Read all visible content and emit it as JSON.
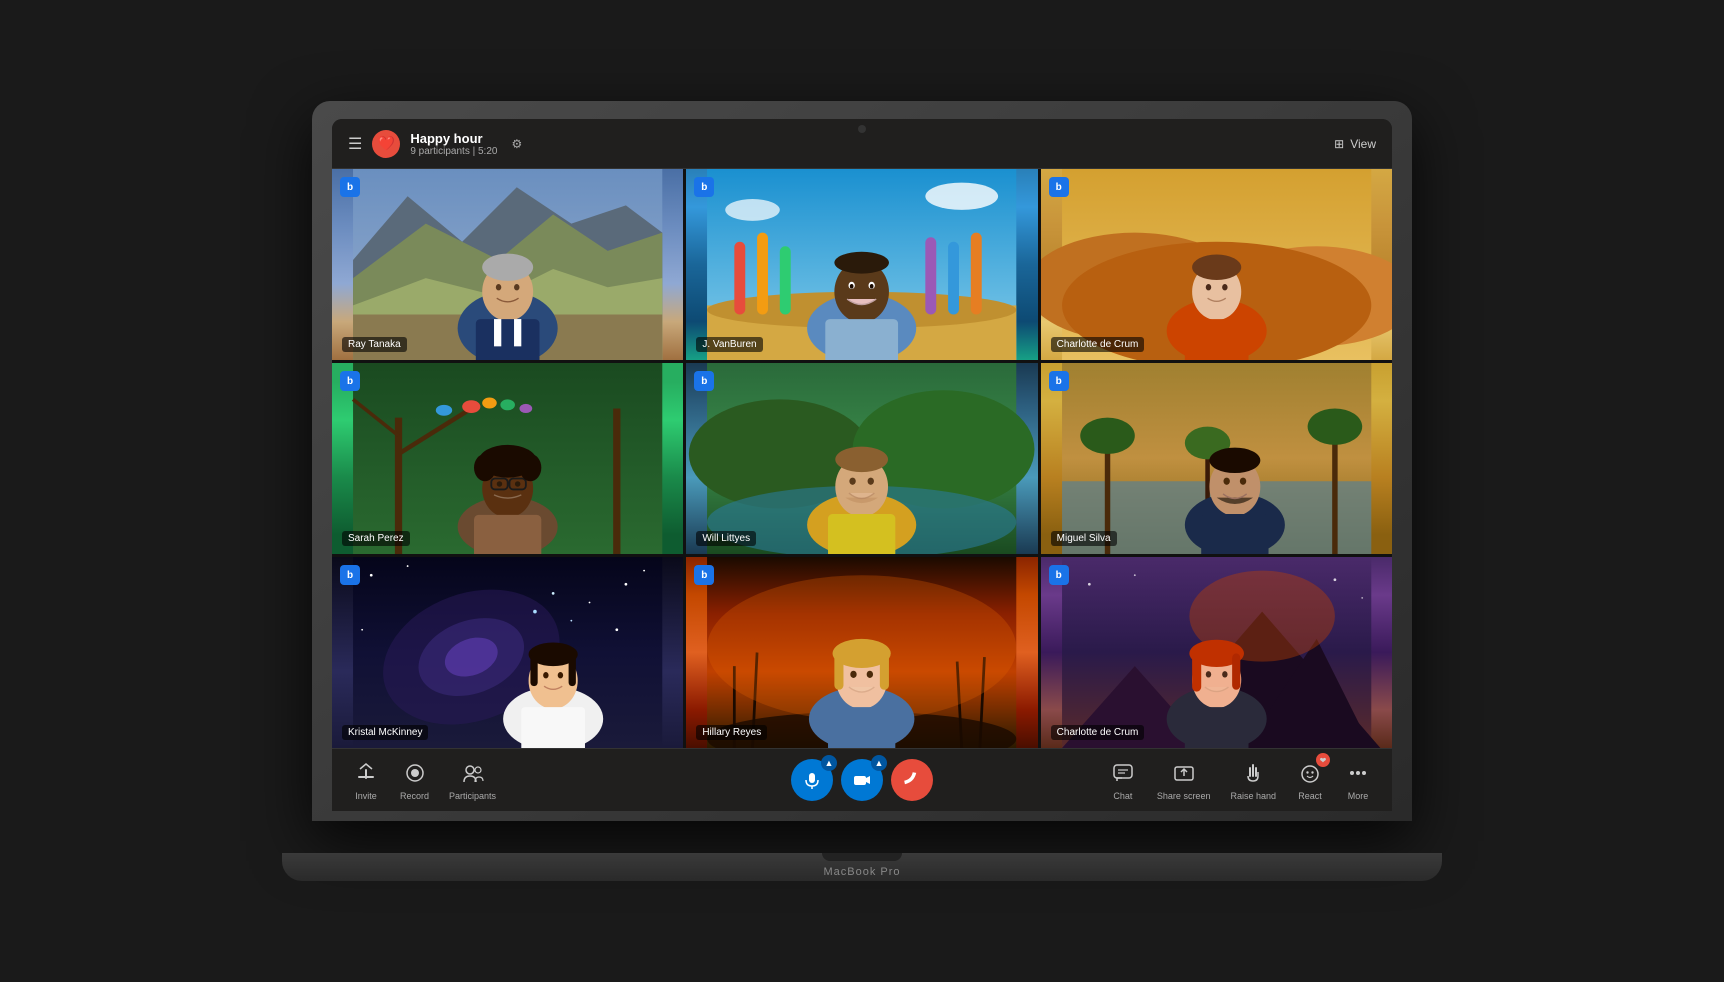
{
  "meeting": {
    "title": "Happy hour",
    "participants_count": "9 participants",
    "duration": "5:20",
    "view_label": "View"
  },
  "participants": [
    {
      "id": 1,
      "name": "Ray Tanaka",
      "tile_class": "tile-1",
      "bg_color": "#5a7fb0"
    },
    {
      "id": 2,
      "name": "J. VanBuren",
      "tile_class": "tile-2",
      "bg_color": "#1a90c0"
    },
    {
      "id": 3,
      "name": "Charlotte de Crum",
      "tile_class": "tile-3",
      "bg_color": "#c89040"
    },
    {
      "id": 4,
      "name": "Sarah Perez",
      "tile_class": "tile-4",
      "bg_color": "#2a8a4a"
    },
    {
      "id": 5,
      "name": "Will Littyes",
      "tile_class": "tile-5",
      "bg_color": "#2a6a8a"
    },
    {
      "id": 6,
      "name": "Miguel Silva",
      "tile_class": "tile-6",
      "bg_color": "#b87a20"
    },
    {
      "id": 7,
      "name": "Kristal McKinney",
      "tile_class": "tile-7",
      "bg_color": "#1a1a3a"
    },
    {
      "id": 8,
      "name": "Hillary Reyes",
      "tile_class": "tile-8",
      "bg_color": "#8b2500"
    },
    {
      "id": 9,
      "name": "Charlotte de Crum",
      "tile_class": "tile-9",
      "bg_color": "#5a2a6a"
    }
  ],
  "controls": {
    "left": [
      {
        "id": "invite",
        "label": "Invite",
        "icon": "⬆"
      },
      {
        "id": "record",
        "label": "Record",
        "icon": "⏺"
      },
      {
        "id": "participants",
        "label": "Participants",
        "icon": "👥"
      }
    ],
    "center": [
      {
        "id": "mic",
        "label": "mic",
        "icon": "🎤",
        "active": true
      },
      {
        "id": "camera",
        "label": "camera",
        "icon": "📷",
        "active": true
      },
      {
        "id": "end",
        "label": "end",
        "icon": "📞",
        "active": false
      }
    ],
    "right": [
      {
        "id": "chat",
        "label": "Chat",
        "icon": "💬"
      },
      {
        "id": "share",
        "label": "Share screen",
        "icon": "⬆"
      },
      {
        "id": "raise-hand",
        "label": "Raise hand",
        "icon": "✋"
      },
      {
        "id": "react",
        "label": "React",
        "icon": "❤"
      },
      {
        "id": "more",
        "label": "More",
        "icon": "⋯"
      }
    ]
  },
  "laptop_brand": "MacBook Pro"
}
